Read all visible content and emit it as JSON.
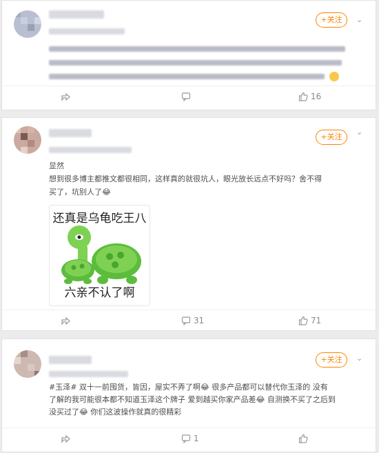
{
  "actions": {
    "follow_label": "+关注",
    "comment_label": "评论",
    "share_label": "转发"
  },
  "posts": [
    {
      "comments": "",
      "likes": "16",
      "lines": []
    },
    {
      "comments": "31",
      "likes": "71",
      "line1": "显然",
      "line2": "想到很多博主都推文都很相同，这样真的就很坑人，眼光放长远点不好吗？舍不得",
      "line3": "买了，坑别人了😂",
      "meme_top": "还真是乌龟吃王八",
      "meme_bottom": "六亲不认了啊"
    },
    {
      "comments": "1",
      "likes": "",
      "line1": "#玉泽# 双十一前囤货，皆因，屋实不弄了啊😂 很多产品都可以替代你玉泽的 没有",
      "line2": "了解的我可能很本都不知道玉泽这个牌子 爱到越买你家产品差😂 自测换不买了之后到",
      "line3": "没买过了😂 你们这波操作就真的很精彩"
    }
  ],
  "colors": {
    "follow": "#ff8200",
    "topic": "#ff8200"
  }
}
